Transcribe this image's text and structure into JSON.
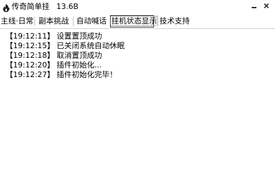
{
  "window": {
    "title": "传奇简单挂",
    "size": "13.6B"
  },
  "icons": {
    "app": "flame-app-icon",
    "minimize": "minimize-icon",
    "close": "close-icon"
  },
  "tabs": [
    {
      "label": "主线·日常",
      "active": false
    },
    {
      "label": "副本挑战",
      "active": false
    },
    {
      "label": "自动喊话",
      "active": false
    },
    {
      "label": "挂机状态显示",
      "active": true
    },
    {
      "label": "技术支持",
      "active": false
    }
  ],
  "log": [
    {
      "time": "【19:12:11】",
      "message": "设置置顶成功"
    },
    {
      "time": "【19:12:15】",
      "message": "已关闭系统自动休眠"
    },
    {
      "time": "【19:12:18】",
      "message": "取消置顶成功"
    },
    {
      "time": "【19:12:20】",
      "message": "插件初始化..."
    },
    {
      "time": "【19:12:27】",
      "message": "插件初始化完毕！"
    }
  ]
}
